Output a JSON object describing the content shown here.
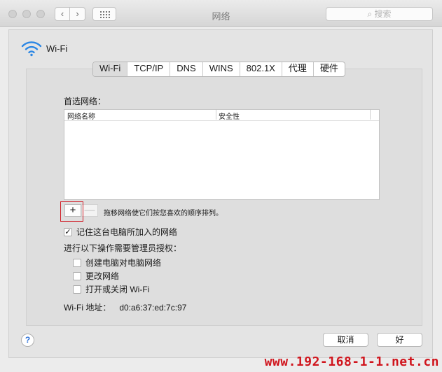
{
  "window": {
    "title": "网络",
    "search_placeholder": "搜索"
  },
  "interface_name": "Wi-Fi",
  "tabs": [
    {
      "label": "Wi-Fi",
      "active": true
    },
    {
      "label": "TCP/IP"
    },
    {
      "label": "DNS"
    },
    {
      "label": "WINS"
    },
    {
      "label": "802.1X"
    },
    {
      "label": "代理"
    },
    {
      "label": "硬件"
    }
  ],
  "preferred": {
    "label": "首选网络：",
    "columns": [
      "网络名称",
      "安全性"
    ],
    "rows": []
  },
  "list_controls": {
    "add": "+",
    "remove": "—",
    "hint": "拖移网络使它们按您喜欢的顺序排列。"
  },
  "remember_networks": {
    "label": "记住这台电脑所加入的网络",
    "checked": true
  },
  "admin": {
    "label": "进行以下操作需要管理员授权：",
    "options": [
      {
        "label": "创建电脑对电脑网络",
        "checked": false
      },
      {
        "label": "更改网络",
        "checked": false
      },
      {
        "label": "打开或关闭 Wi-Fi",
        "checked": false
      }
    ]
  },
  "address": {
    "label": "Wi-Fi 地址：",
    "value": "d0:a6:37:ed:7c:97"
  },
  "buttons": {
    "help": "?",
    "cancel": "取消",
    "ok": "好"
  },
  "watermark": "www.192-168-1-1.net.cn",
  "colors": {
    "highlight": "#d0202a",
    "wifi": "#2a86e4",
    "watermark": "#d0151d"
  }
}
